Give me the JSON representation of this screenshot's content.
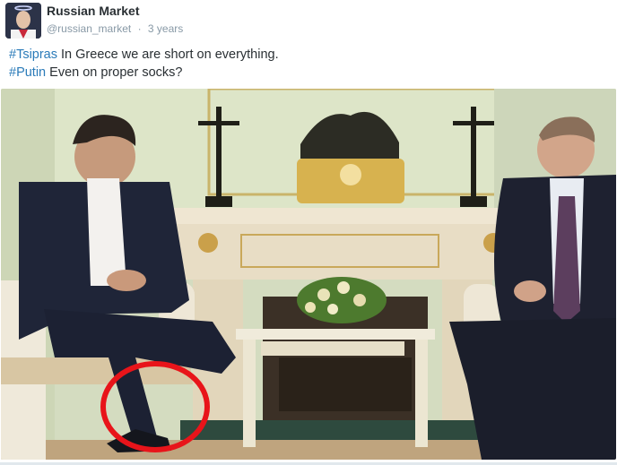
{
  "tweet": {
    "display_name": "Russian Market",
    "handle": "@russian_market",
    "separator": "·",
    "timestamp": "3 years",
    "lines": [
      {
        "hashtag": "#Tsipras",
        "text": " In Greece we are short on everything."
      },
      {
        "hashtag": "#Putin",
        "text": " Even on proper socks?"
      }
    ]
  },
  "colors": {
    "hashtag": "#2b7bb9",
    "name": "#292f33",
    "meta": "#8899a6",
    "circle": "#e8141a"
  },
  "icons": {
    "avatar": "avatar-image"
  }
}
